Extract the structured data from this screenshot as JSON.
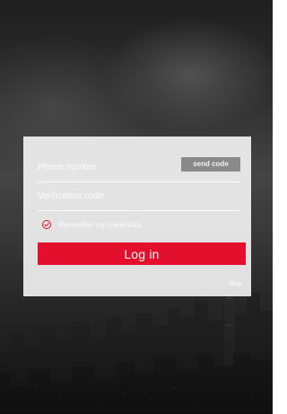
{
  "login": {
    "phone_placeholder": "Phone number",
    "send_code_label": "send code",
    "verification_placeholder": "Verification code",
    "remember_label": "Remember my credentials",
    "login_label": "Log in",
    "skip_label": "Skip"
  },
  "colors": {
    "accent_red": "#e30f2c",
    "send_code_bg": "#8a8a8a",
    "panel_bg": "rgba(255,255,255,0.86)"
  },
  "icons": {
    "remember": "checkmark-circle-icon"
  },
  "state": {
    "remember_checked": true
  }
}
